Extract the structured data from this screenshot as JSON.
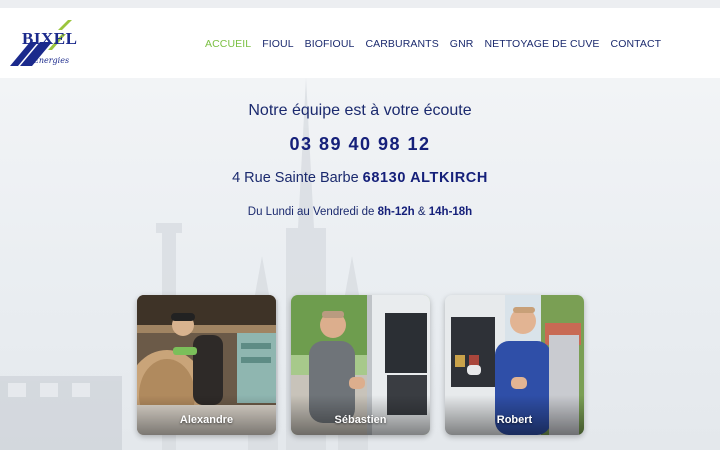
{
  "logo": {
    "name": "BIXEL",
    "tagline": "Energies"
  },
  "nav": [
    {
      "label": "ACCUEIL",
      "active": true
    },
    {
      "label": "FIOUL",
      "active": false
    },
    {
      "label": "BIOFIOUL",
      "active": false
    },
    {
      "label": "CARBURANTS",
      "active": false
    },
    {
      "label": "GNR",
      "active": false
    },
    {
      "label": "NETTOYAGE DE CUVE",
      "active": false
    },
    {
      "label": "CONTACT",
      "active": false
    }
  ],
  "hero": {
    "heading": "Notre équipe est à votre écoute",
    "phone": "03 89 40 98 12",
    "address_street": "4 Rue Sainte Barbe",
    "address_city": "68130 ALTKIRCH",
    "hours_prefix": "Du Lundi au Vendredi de",
    "hours_morning": "8h-12h",
    "hours_and": "&",
    "hours_afternoon": "14h-18h"
  },
  "team": [
    {
      "name": "Alexandre"
    },
    {
      "name": "Sébastien"
    },
    {
      "name": "Robert"
    }
  ],
  "colors": {
    "brand_blue": "#1b2a8c",
    "accent_green": "#7bc043",
    "nav_text": "#1b2a6e"
  }
}
